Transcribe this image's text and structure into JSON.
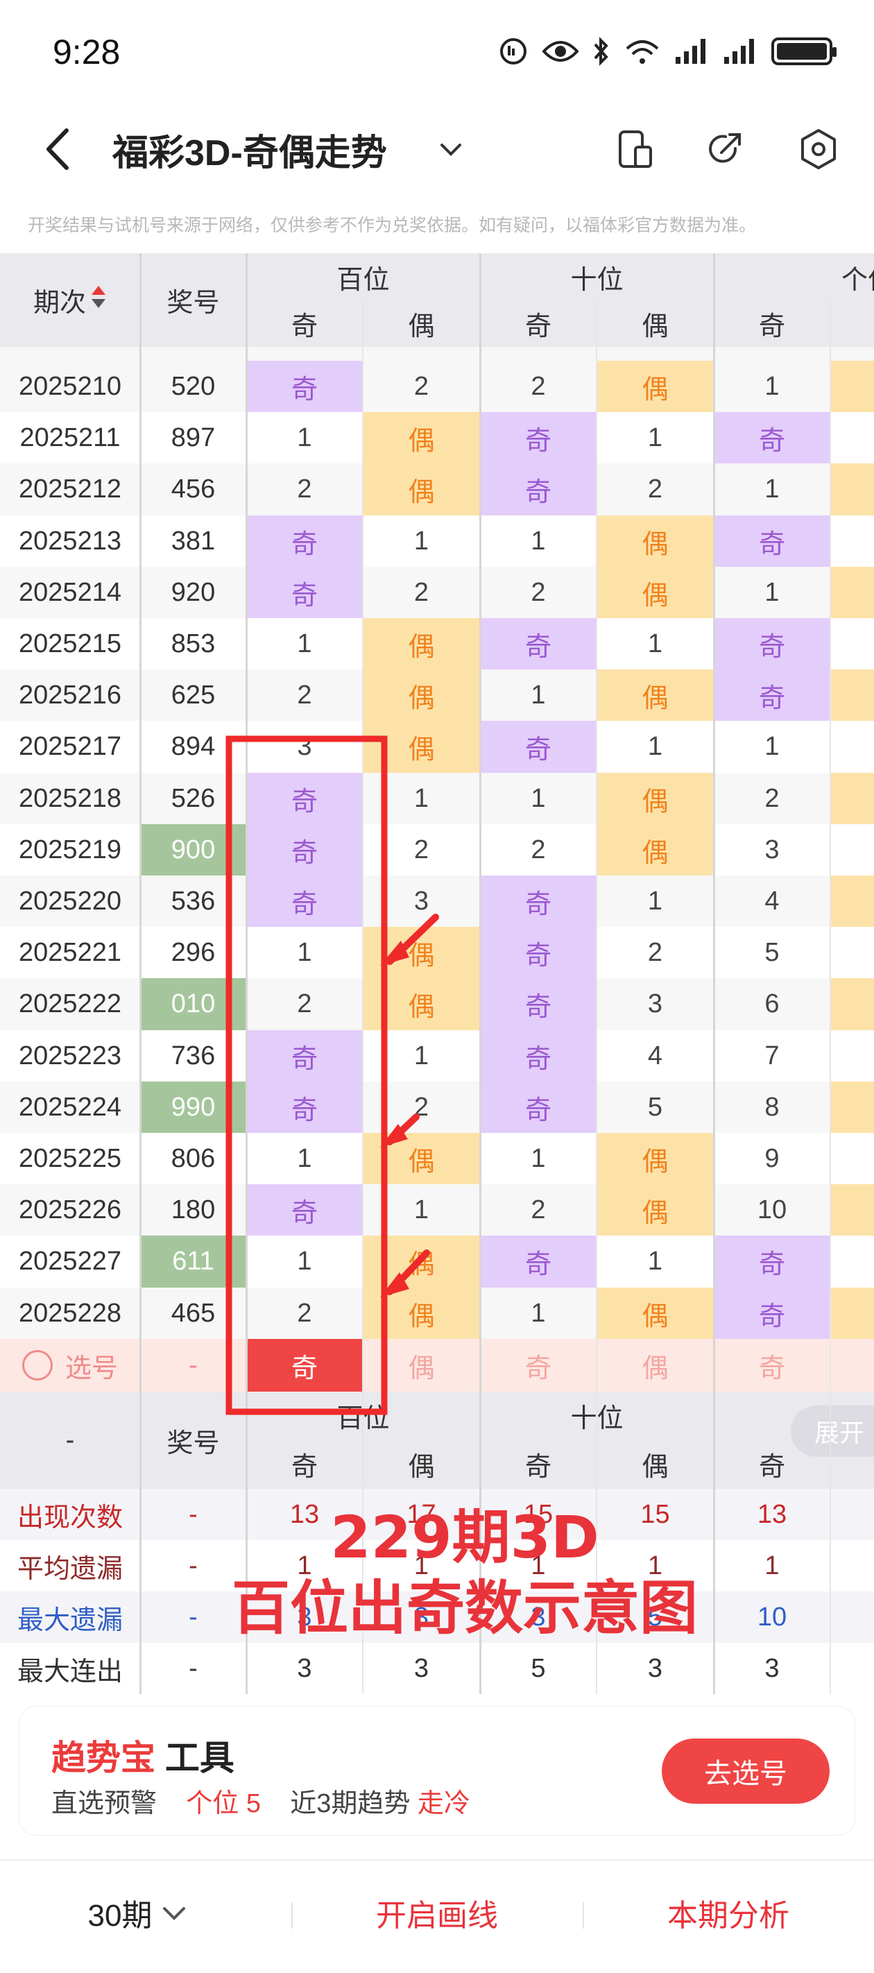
{
  "status_bar": {
    "time": "9:28",
    "icons": [
      "alarm-off-icon",
      "eye-icon",
      "bluetooth-icon",
      "wifi-6-icon",
      "signal-icon",
      "signal-icon",
      "battery-charging-icon"
    ]
  },
  "header": {
    "title": "福彩3D-奇偶走势",
    "actions": [
      "phone-split-icon",
      "share-icon",
      "settings-icon"
    ]
  },
  "disclaimer": "开奖结果与试机号来源于网络，仅供参考不作为兑奖依据。如有疑问，以福体彩官方数据为准。",
  "table": {
    "col_period": "期次",
    "col_number": "奖号",
    "groups": [
      "百位",
      "十位",
      "个位"
    ],
    "sub_odd": "奇",
    "sub_even": "偶",
    "rows": [
      {
        "period": "2025210",
        "number": "520",
        "highlight": false,
        "bai": [
          "奇",
          "2"
        ],
        "shi": [
          "2",
          "偶"
        ],
        "ge": [
          "1",
          ""
        ]
      },
      {
        "period": "2025211",
        "number": "897",
        "highlight": false,
        "bai": [
          "1",
          "偶"
        ],
        "shi": [
          "奇",
          "1"
        ],
        "ge": [
          "奇",
          ""
        ]
      },
      {
        "period": "2025212",
        "number": "456",
        "highlight": false,
        "bai": [
          "2",
          "偶"
        ],
        "shi": [
          "奇",
          "2"
        ],
        "ge": [
          "1",
          ""
        ]
      },
      {
        "period": "2025213",
        "number": "381",
        "highlight": false,
        "bai": [
          "奇",
          "1"
        ],
        "shi": [
          "1",
          "偶"
        ],
        "ge": [
          "奇",
          ""
        ]
      },
      {
        "period": "2025214",
        "number": "920",
        "highlight": false,
        "bai": [
          "奇",
          "2"
        ],
        "shi": [
          "2",
          "偶"
        ],
        "ge": [
          "1",
          ""
        ]
      },
      {
        "period": "2025215",
        "number": "853",
        "highlight": false,
        "bai": [
          "1",
          "偶"
        ],
        "shi": [
          "奇",
          "1"
        ],
        "ge": [
          "奇",
          ""
        ]
      },
      {
        "period": "2025216",
        "number": "625",
        "highlight": false,
        "bai": [
          "2",
          "偶"
        ],
        "shi": [
          "1",
          "偶"
        ],
        "ge": [
          "奇",
          ""
        ]
      },
      {
        "period": "2025217",
        "number": "894",
        "highlight": false,
        "bai": [
          "3",
          "偶"
        ],
        "shi": [
          "奇",
          "1"
        ],
        "ge": [
          "1",
          ""
        ]
      },
      {
        "period": "2025218",
        "number": "526",
        "highlight": false,
        "bai": [
          "奇",
          "1"
        ],
        "shi": [
          "1",
          "偶"
        ],
        "ge": [
          "2",
          ""
        ]
      },
      {
        "period": "2025219",
        "number": "900",
        "highlight": true,
        "bai": [
          "奇",
          "2"
        ],
        "shi": [
          "2",
          "偶"
        ],
        "ge": [
          "3",
          ""
        ]
      },
      {
        "period": "2025220",
        "number": "536",
        "highlight": false,
        "bai": [
          "奇",
          "3"
        ],
        "shi": [
          "奇",
          "1"
        ],
        "ge": [
          "4",
          ""
        ]
      },
      {
        "period": "2025221",
        "number": "296",
        "highlight": false,
        "bai": [
          "1",
          "偶"
        ],
        "shi": [
          "奇",
          "2"
        ],
        "ge": [
          "5",
          ""
        ]
      },
      {
        "period": "2025222",
        "number": "010",
        "highlight": true,
        "bai": [
          "2",
          "偶"
        ],
        "shi": [
          "奇",
          "3"
        ],
        "ge": [
          "6",
          ""
        ]
      },
      {
        "period": "2025223",
        "number": "736",
        "highlight": false,
        "bai": [
          "奇",
          "1"
        ],
        "shi": [
          "奇",
          "4"
        ],
        "ge": [
          "7",
          ""
        ]
      },
      {
        "period": "2025224",
        "number": "990",
        "highlight": true,
        "bai": [
          "奇",
          "2"
        ],
        "shi": [
          "奇",
          "5"
        ],
        "ge": [
          "8",
          ""
        ]
      },
      {
        "period": "2025225",
        "number": "806",
        "highlight": false,
        "bai": [
          "1",
          "偶"
        ],
        "shi": [
          "1",
          "偶"
        ],
        "ge": [
          "9",
          ""
        ]
      },
      {
        "period": "2025226",
        "number": "180",
        "highlight": false,
        "bai": [
          "奇",
          "1"
        ],
        "shi": [
          "2",
          "偶"
        ],
        "ge": [
          "10",
          ""
        ]
      },
      {
        "period": "2025227",
        "number": "611",
        "highlight": true,
        "bai": [
          "1",
          "偶"
        ],
        "shi": [
          "奇",
          "1"
        ],
        "ge": [
          "奇",
          ""
        ]
      },
      {
        "period": "2025228",
        "number": "465",
        "highlight": false,
        "bai": [
          "2",
          "偶"
        ],
        "shi": [
          "1",
          "偶"
        ],
        "ge": [
          "奇",
          ""
        ]
      }
    ],
    "select_row": {
      "label": "选号",
      "number": "-",
      "cells": [
        "奇",
        "偶",
        "奇",
        "偶",
        "奇"
      ]
    },
    "footer_header": {
      "period": "-",
      "number": "奖号",
      "expand_label": "展开"
    },
    "stats": [
      {
        "label": "出现次数",
        "number": "-",
        "values": [
          "13",
          "17",
          "15",
          "15",
          "13"
        ],
        "label_color": "#c62828",
        "value_color": "#c62828"
      },
      {
        "label": "平均遗漏",
        "number": "-",
        "values": [
          "1",
          "1",
          "1",
          "1",
          "1"
        ],
        "label_color": "#8e2a2a",
        "value_color": "#8e2a2a"
      },
      {
        "label": "最大遗漏",
        "number": "-",
        "values": [
          "3",
          "3",
          "3",
          "5",
          "10"
        ],
        "label_color": "#2f5fc4",
        "value_color": "#2f5fc4"
      },
      {
        "label": "最大连出",
        "number": "-",
        "values": [
          "3",
          "3",
          "5",
          "3",
          "3"
        ],
        "label_color": "#333333",
        "value_color": "#333333"
      }
    ]
  },
  "annotation": {
    "line1": "229期3D",
    "line2": "百位出奇数示意图"
  },
  "tool_card": {
    "brand": "趋势宝",
    "title_rest": "工具",
    "sub_prefix": "直选预警",
    "sub_pos": "个位",
    "sub_pos_val": "5",
    "sub_trend": "近3期趋势",
    "sub_trend_val": "走冷",
    "button": "去选号"
  },
  "bottom_bar": {
    "periods": "30期",
    "draw_lines": "开启画线",
    "analysis": "本期分析"
  },
  "colors": {
    "odd_bg": "#e3cdfb",
    "odd_text": "#9b59d0",
    "even_bg": "#fde2a8",
    "even_text": "#f0821e",
    "highlight_green": "#a5c69c",
    "accent_red": "#f04545",
    "select_row_bg": "#fde8e4"
  }
}
